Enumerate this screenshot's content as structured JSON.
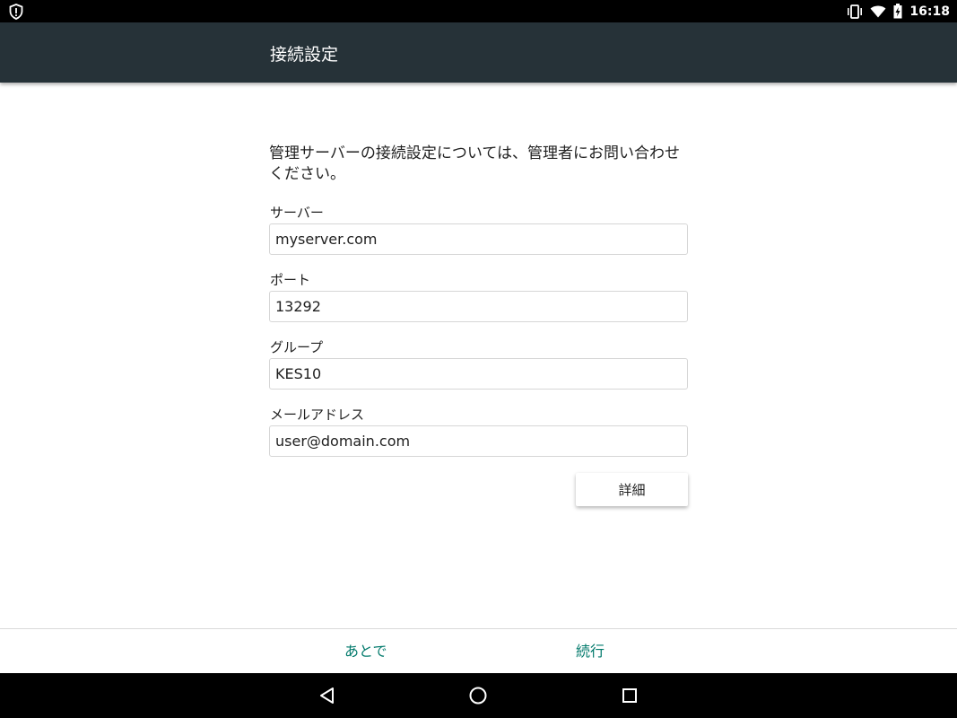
{
  "status_bar": {
    "time": "16:18",
    "icons": [
      "shield-icon",
      "vibrate-icon",
      "wifi-icon",
      "battery-charging-icon"
    ]
  },
  "app_bar": {
    "title": "接続設定"
  },
  "form": {
    "intro": "管理サーバーの接続設定については、管理者にお問い合わせください。",
    "server": {
      "label": "サーバー",
      "value": "myserver.com"
    },
    "port": {
      "label": "ポート",
      "value": "13292"
    },
    "group": {
      "label": "グループ",
      "value": "KES10"
    },
    "email": {
      "label": "メールアドレス",
      "value": "user@domain.com"
    },
    "details_button": "詳細"
  },
  "bottom_bar": {
    "later": "あとで",
    "continue": "続行"
  },
  "nav_bar": {
    "icons": [
      "back-icon",
      "home-icon",
      "recents-icon"
    ]
  },
  "colors": {
    "app_bar": "#263238",
    "accent": "#00796b",
    "status_bar": "#000000"
  }
}
